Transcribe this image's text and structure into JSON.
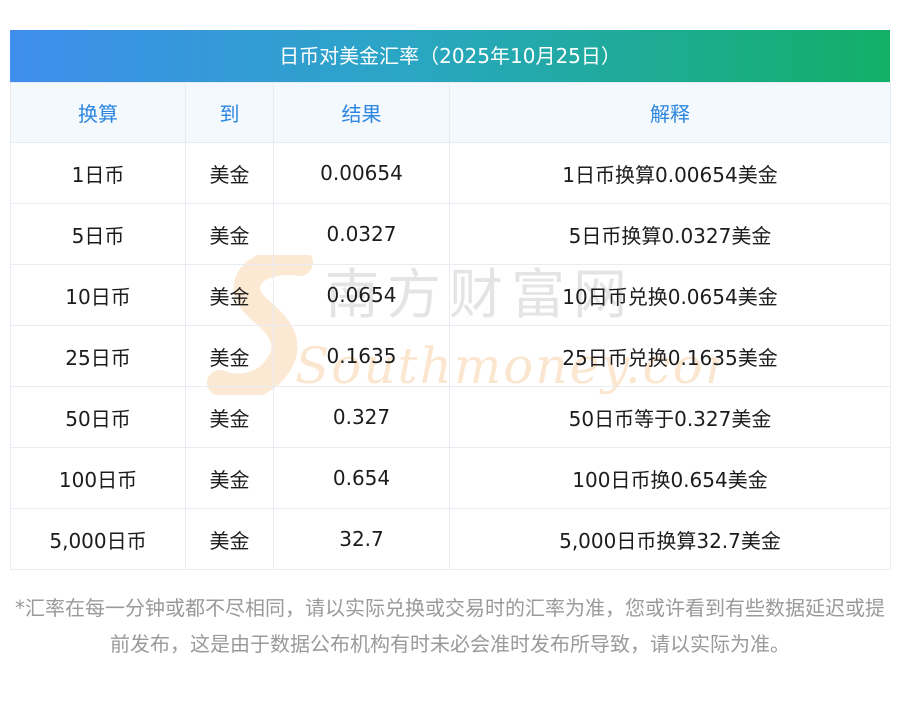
{
  "title": "日币对美金汇率（2025年10月25日）",
  "table": {
    "headers": [
      "换算",
      "到",
      "结果",
      "解释"
    ],
    "rows": [
      [
        "1日币",
        "美金",
        "0.00654",
        "1日币换算0.00654美金"
      ],
      [
        "5日币",
        "美金",
        "0.0327",
        "5日币换算0.0327美金"
      ],
      [
        "10日币",
        "美金",
        "0.0654",
        "10日币兑换0.0654美金"
      ],
      [
        "25日币",
        "美金",
        "0.1635",
        "25日币兑换0.1635美金"
      ],
      [
        "50日币",
        "美金",
        "0.327",
        "50日币等于0.327美金"
      ],
      [
        "100日币",
        "美金",
        "0.654",
        "100日币换0.654美金"
      ],
      [
        "5,000日币",
        "美金",
        "32.7",
        "5,000日币换算32.7美金"
      ]
    ]
  },
  "watermark": {
    "cn": "南方财富网",
    "en": "Southmoney.com"
  },
  "footnote": "*汇率在每一分钟或都不尽相同，请以实际兑换或交易时的汇率为准，您或许看到有些数据延迟或提前发布，这是由于数据公布机构有时未必会准时发布所导致，请以实际为准。",
  "colors": {
    "header_text": "#2d86e0",
    "title_gradient_start": "#3f8ded",
    "title_gradient_end": "#12b067",
    "footnote_text": "#9a9a9a"
  }
}
